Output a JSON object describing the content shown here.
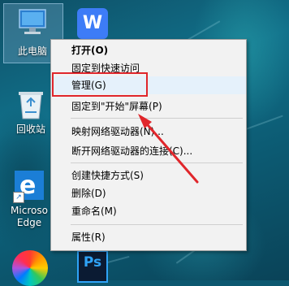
{
  "desktop": {
    "icons": [
      {
        "label": "此电脑",
        "icon": "computer-icon"
      },
      {
        "label": "W",
        "icon": "wps-icon"
      },
      {
        "label": "回收站",
        "icon": "recycle-bin-icon"
      },
      {
        "label": "Microsoft Edge",
        "line1": "Microso",
        "line2": "Edge",
        "icon": "edge-icon"
      },
      {
        "label": "",
        "icon": "color-wheel-icon"
      },
      {
        "label": "Ps",
        "icon": "photoshop-icon"
      }
    ]
  },
  "context_menu": {
    "items": [
      {
        "label": "打开(O)",
        "bold": true
      },
      {
        "label": "固定到快速访问"
      },
      {
        "label": "管理(G)",
        "highlighted": true
      },
      {
        "label": "固定到\"开始\"屏幕(P)"
      },
      {
        "label": "映射网络驱动器(N)..."
      },
      {
        "label": "断开网络驱动器的连接(C)..."
      },
      {
        "label": "创建快捷方式(S)"
      },
      {
        "label": "删除(D)"
      },
      {
        "label": "重命名(M)"
      },
      {
        "label": "属性(R)"
      }
    ]
  },
  "annotation": {
    "highlight_color": "#e0262b"
  }
}
